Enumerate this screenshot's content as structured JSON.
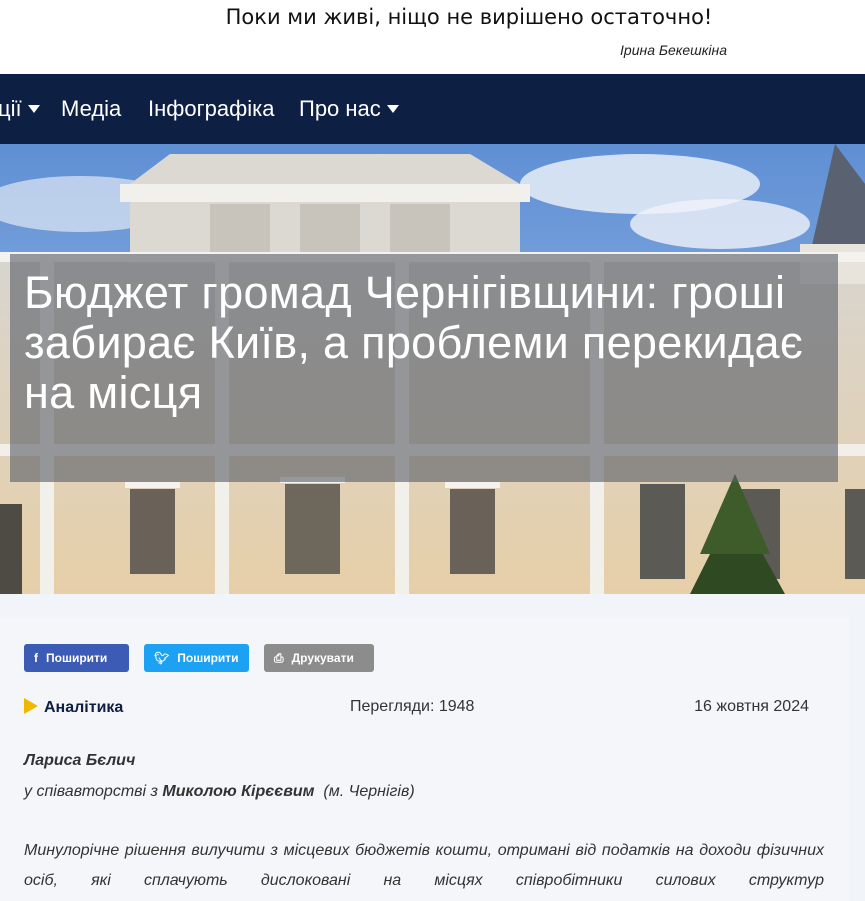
{
  "quote": {
    "text": "Поки ми живі, ніщо не вирішено остаточно!",
    "author": "Ірина Бекешкіна"
  },
  "nav": {
    "items": [
      {
        "label": "ції",
        "has_dropdown": true
      },
      {
        "label": "Медіа",
        "has_dropdown": false
      },
      {
        "label": "Інфографіка",
        "has_dropdown": false
      },
      {
        "label": "Про нас",
        "has_dropdown": true
      }
    ],
    "bg_color": "#0e1f44"
  },
  "article": {
    "title": "Бюджет громад Чернігівщини: гроші забирає Київ, а проблеми перекидає на місця",
    "share": {
      "facebook_label": "Поширити",
      "twitter_label": "Поширити",
      "print_label": "Друкувати",
      "facebook_icon": "facebook-icon",
      "twitter_icon": "twitter-icon",
      "print_icon": "printer-icon"
    },
    "category": "Аналітика",
    "views": "Перегляди: 1948",
    "date": "16 жовтня 2024",
    "author": "Лариса Бєлич",
    "coauthor_prefix": "у співавторстві з",
    "coauthor_name": "Миколою Кірєєвим",
    "coauthor_city": "(м. Чернігів)",
    "lead": "Минулорічне рішення вилучити з місцевих бюджетів кошти, отримані від податків на доходи фізичних осіб, які сплачують дислоковані на місцях співробітники силових структур"
  },
  "colors": {
    "accent_yellow": "#f1b800",
    "facebook": "#3b5bb5",
    "twitter": "#1da1f2",
    "print": "#8c8c8c"
  }
}
